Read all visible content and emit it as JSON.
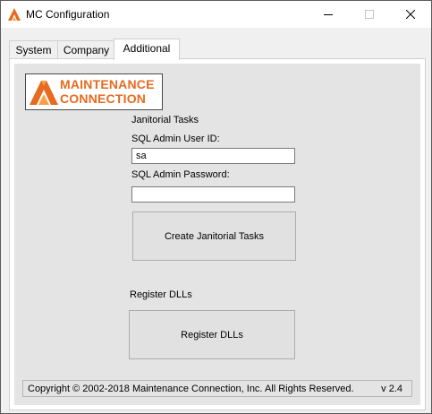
{
  "window": {
    "title": "MC Configuration",
    "icon": "maintenance-connection-icon",
    "controls": [
      "minimize-icon",
      "maximize-icon",
      "close-icon"
    ]
  },
  "tabs": [
    {
      "label": "System",
      "selected": false
    },
    {
      "label": "Company",
      "selected": false
    },
    {
      "label": "Additional",
      "selected": true
    }
  ],
  "logo": {
    "line1": "MAINTENANCE",
    "line2": "CONNECTION",
    "brand_color": "#e66a1f"
  },
  "janitorial": {
    "section_label": "Janitorial Tasks",
    "user_id_label": "SQL Admin User ID:",
    "user_id_value": "sa",
    "password_label": "SQL Admin Password:",
    "password_value": "",
    "create_button_label": "Create Janitorial Tasks"
  },
  "register": {
    "section_label": "Register DLLs",
    "button_label": "Register DLLs"
  },
  "footer": {
    "copyright": "Copyright © 2002-2018 Maintenance Connection, Inc. All Rights Reserved.",
    "version": "v 2.4"
  }
}
